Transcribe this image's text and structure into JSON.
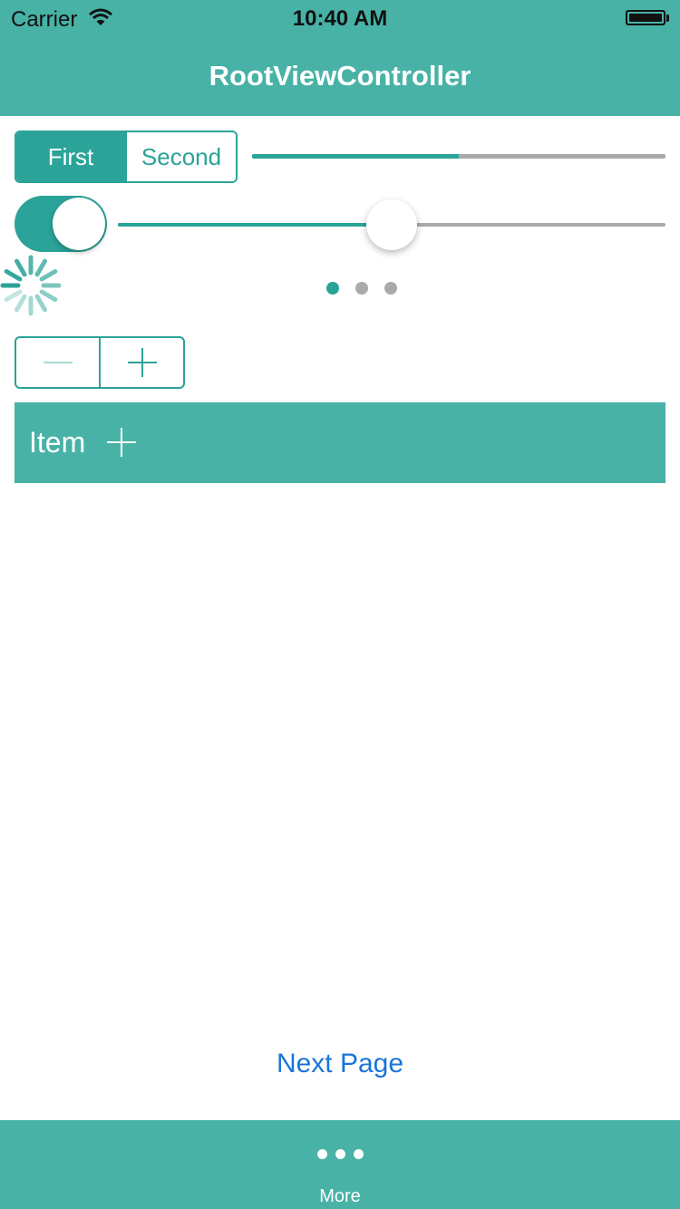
{
  "status_bar": {
    "carrier": "Carrier",
    "time": "10:40 AM",
    "wifi_icon": "wifi-icon",
    "battery_icon": "battery-icon",
    "battery_level": 1.0
  },
  "nav": {
    "title": "RootViewController"
  },
  "segmented": {
    "segments": [
      "First",
      "Second"
    ],
    "selected": 0
  },
  "progress": {
    "value": 0.5
  },
  "switch": {
    "on": true
  },
  "slider": {
    "value": 0.5
  },
  "activity_indicator": {
    "animating": true
  },
  "page_control": {
    "pages": 3,
    "current": 0
  },
  "stepper": {
    "minus_icon": "minus-icon",
    "plus_icon": "plus-icon",
    "minus_enabled": false
  },
  "item_bar": {
    "label": "Item",
    "add_icon": "plus-icon"
  },
  "next_page": {
    "label": "Next Page"
  },
  "tab_bar": {
    "items": [
      {
        "label": "More",
        "icon": "more-icon"
      }
    ]
  },
  "colors": {
    "accent": "#2ba398",
    "bar": "#48b2a6",
    "track": "#aaaaaa",
    "link": "#1a75d9"
  }
}
